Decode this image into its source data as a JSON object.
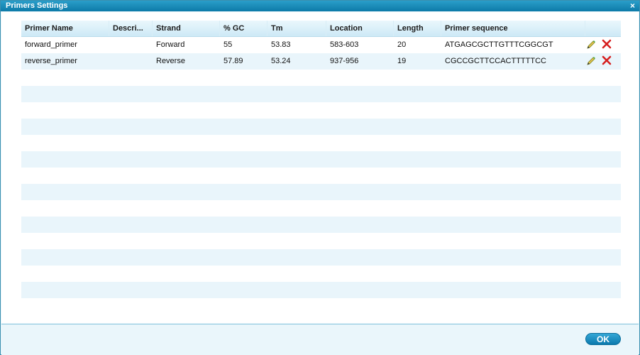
{
  "window": {
    "title": "Primers Settings",
    "close_label": "×"
  },
  "table": {
    "columns": [
      "Primer Name",
      "Descri...",
      "Strand",
      "% GC",
      "Tm",
      "Location",
      "Length",
      "Primer sequence"
    ],
    "rows": [
      {
        "name": "forward_primer",
        "description": "",
        "strand": "Forward",
        "gc": "55",
        "tm": "53.83",
        "location": "583-603",
        "length": "20",
        "sequence": "ATGAGCGCTTGTTTCGGCGT"
      },
      {
        "name": "reverse_primer",
        "description": "",
        "strand": "Reverse",
        "gc": "57.89",
        "tm": "53.24",
        "location": "937-956",
        "length": "19",
        "sequence": "CGCCGCTTCCACTTTTTCC"
      }
    ],
    "row_icons": [
      "pencil-icon",
      "delete-icon"
    ]
  },
  "footer": {
    "ok_label": "OK"
  },
  "colors": {
    "title_bar": "#0d7aa8",
    "header": "#cde9f6",
    "alt_row": "#e9f5fb",
    "ok_button": "#0c79ad",
    "delete": "#d62020"
  }
}
